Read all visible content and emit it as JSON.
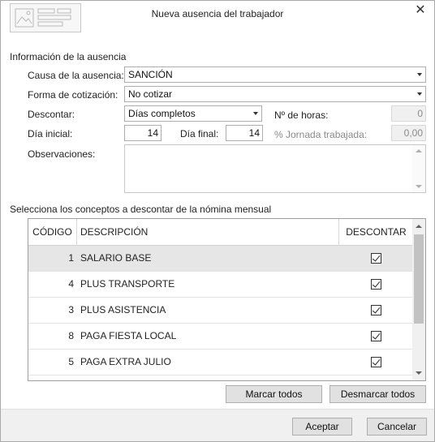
{
  "window": {
    "title": "Nueva ausencia del trabajador",
    "close_icon": "close-icon",
    "logo_icon": "form-document-icon"
  },
  "info": {
    "section_title": "Información de la ausencia",
    "causa_label": "Causa de la ausencia:",
    "causa_value": "SANCIÓN",
    "forma_label": "Forma de cotización:",
    "forma_value": "No cotizar",
    "descontar_label": "Descontar:",
    "descontar_value": "Días completos",
    "horas_label": "Nº de horas:",
    "horas_value": "0",
    "dia_inicial_label": "Día inicial:",
    "dia_inicial_value": "14",
    "dia_final_label": "Día final:",
    "dia_final_value": "14",
    "jornada_label": "% Jornada trabajada:",
    "jornada_value": "0,00",
    "observaciones_label": "Observaciones:",
    "observaciones_value": ""
  },
  "concepts": {
    "section_title": "Selecciona los conceptos a descontar de la nómina mensual",
    "columns": {
      "code": "CÓDIGO",
      "description": "DESCRIPCIÓN",
      "discount": "DESCONTAR"
    },
    "rows": [
      {
        "code": "1",
        "description": "SALARIO BASE",
        "checked": true,
        "selected": true
      },
      {
        "code": "4",
        "description": "PLUS TRANSPORTE",
        "checked": true,
        "selected": false
      },
      {
        "code": "3",
        "description": "PLUS ASISTENCIA",
        "checked": true,
        "selected": false
      },
      {
        "code": "8",
        "description": "PAGA FIESTA LOCAL",
        "checked": true,
        "selected": false
      },
      {
        "code": "5",
        "description": "PAGA EXTRA JULIO",
        "checked": true,
        "selected": false
      }
    ],
    "mark_all": "Marcar todos",
    "unmark_all": "Desmarcar todos"
  },
  "footer": {
    "accept": "Aceptar",
    "cancel": "Cancelar"
  },
  "colors": {
    "selected_row": "#e6e6e6",
    "footer_bg": "#f0f0f0",
    "button_bg": "#e1e1e1"
  }
}
